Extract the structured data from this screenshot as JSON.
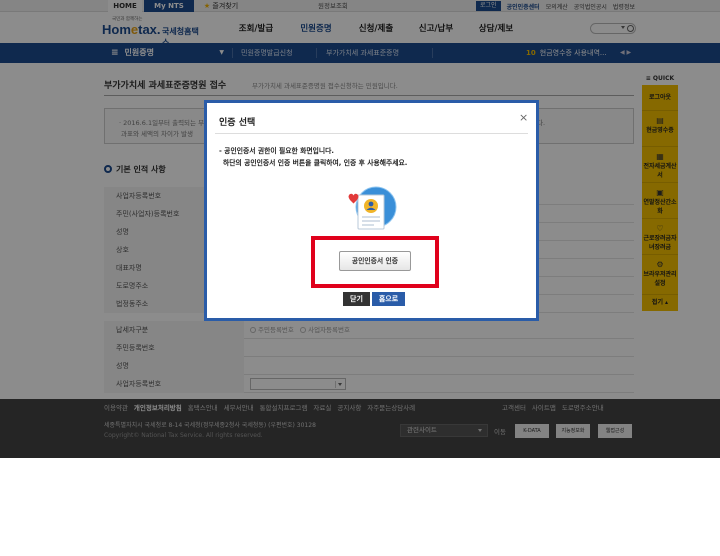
{
  "topbar": {
    "home": "HOME",
    "mynts": "My NTS",
    "favorites": "즐겨찾기",
    "mid": "원정보조회",
    "login": "로그인",
    "cert_center": "공인인증센터",
    "mock_calc": "모의계산",
    "public_notice": "공익법인공시",
    "law_info": "법령정보"
  },
  "header": {
    "logo_tag": "국민과 함께하는",
    "logo_brand_a": "Hom",
    "logo_brand_e": "e",
    "logo_brand_b": "tax.",
    "logo_kr": "국세청홈택스",
    "gnb": [
      "조회/발급",
      "민원증명",
      "신청/제출",
      "신고/납부",
      "상담/제보"
    ]
  },
  "navbar": {
    "menu": "민원증명",
    "crumb1": "민원증명발급신청",
    "crumb2": "부가가치세 과세표준증명",
    "notice_num": "10",
    "notice_text": "현금영수증 사용내역..."
  },
  "content": {
    "title": "부가가치세 과세표준증명원 접수",
    "subtitle": "부가가치세 과세표준증명원 접수신청하는 민원입니다.",
    "info_l1": "· 2016.6.1일부터 출력되는 부",
    "info_l2": "과표와 세액의 차이가 발생",
    "info_r1": "다.",
    "section": "기본 인적 사항",
    "rows": [
      "사업자등록번호",
      "주민(사업자)등록번호",
      "성명",
      "상호",
      "대표자명",
      "도로명주소",
      "법정동주소"
    ],
    "rows2": [
      "납세자구분",
      "주민등록번호",
      "성명",
      "사업자등록번호"
    ],
    "radio1": "주민등록번호",
    "radio2": "사업자등록번호"
  },
  "quick": {
    "head": "QUICK",
    "items": [
      "로그아웃",
      "현금영수증",
      "전자세금계산서",
      "연말정산간소화",
      "근로장려금자녀장려금",
      "브라우저관리설정"
    ],
    "fold": "접기"
  },
  "footer": {
    "links": [
      "이용약관",
      "개인정보처리방침",
      "홈택스안내",
      "세무서안내",
      "통합설치프로그램",
      "자료실",
      "공지사항",
      "자주묻는상담사례"
    ],
    "links_bold_index": 1,
    "links_right": [
      "고객센터",
      "사이트맵",
      "도로명주소안내"
    ],
    "address": "세종특별자치시 국세청로 8-14 국세청(정부세종2청사 국세청동) (우편번호) 30128",
    "copyright": "Copyright© National Tax Service. All rights reserved.",
    "related": "관련사이트",
    "go": "이동",
    "badges": [
      "K-DATA",
      "지능정보화",
      "웹접근성"
    ]
  },
  "modal": {
    "title": "인증 선택",
    "close": "×",
    "msg1": "- 공인인증서 권한이 필요한 화면입니다.",
    "msg2": "하단의 공인인증서 인증 버튼을 클릭하여, 인증 후 사용해주세요.",
    "cert_button": "공인인증서 인증",
    "close_button": "닫기",
    "top_button": "홈으로"
  },
  "colors": {
    "brand_blue": "#1d4b8f",
    "quick_yellow": "#f5c000",
    "highlight_red": "#e0001b",
    "modal_border": "#2a5ca8"
  }
}
